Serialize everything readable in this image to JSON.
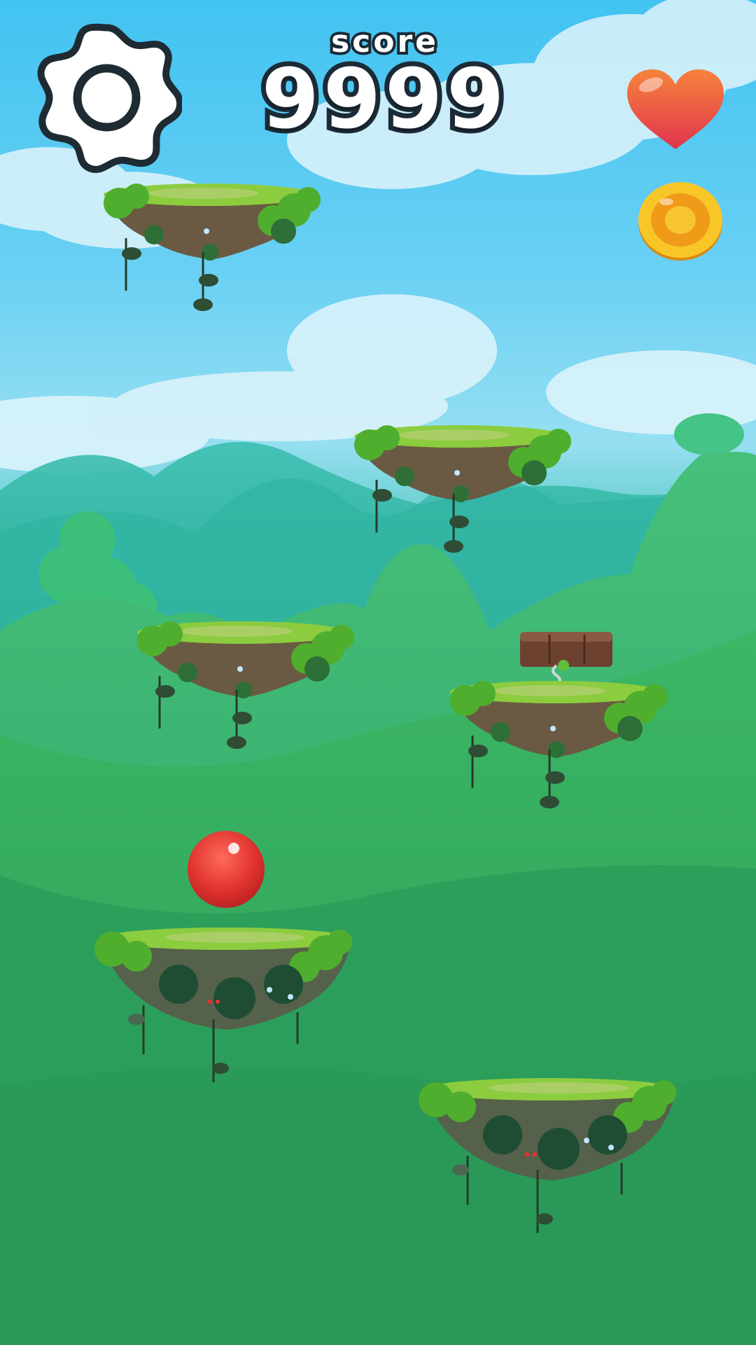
{
  "hud": {
    "score_label": "score",
    "score_value": "9999",
    "settings_icon": "gear-icon",
    "lives_icon": "heart-icon",
    "coins_icon": "coin-icon"
  },
  "world": {
    "player": "red-ball",
    "platform_count": 7,
    "spring_platform": "wooden-crate-spring"
  },
  "colors": {
    "sky": "#42c3f1",
    "hills": "#2fa45a",
    "ball": "#e0342f",
    "heart": "#ef5a4a",
    "coin": "#f5b31c"
  }
}
